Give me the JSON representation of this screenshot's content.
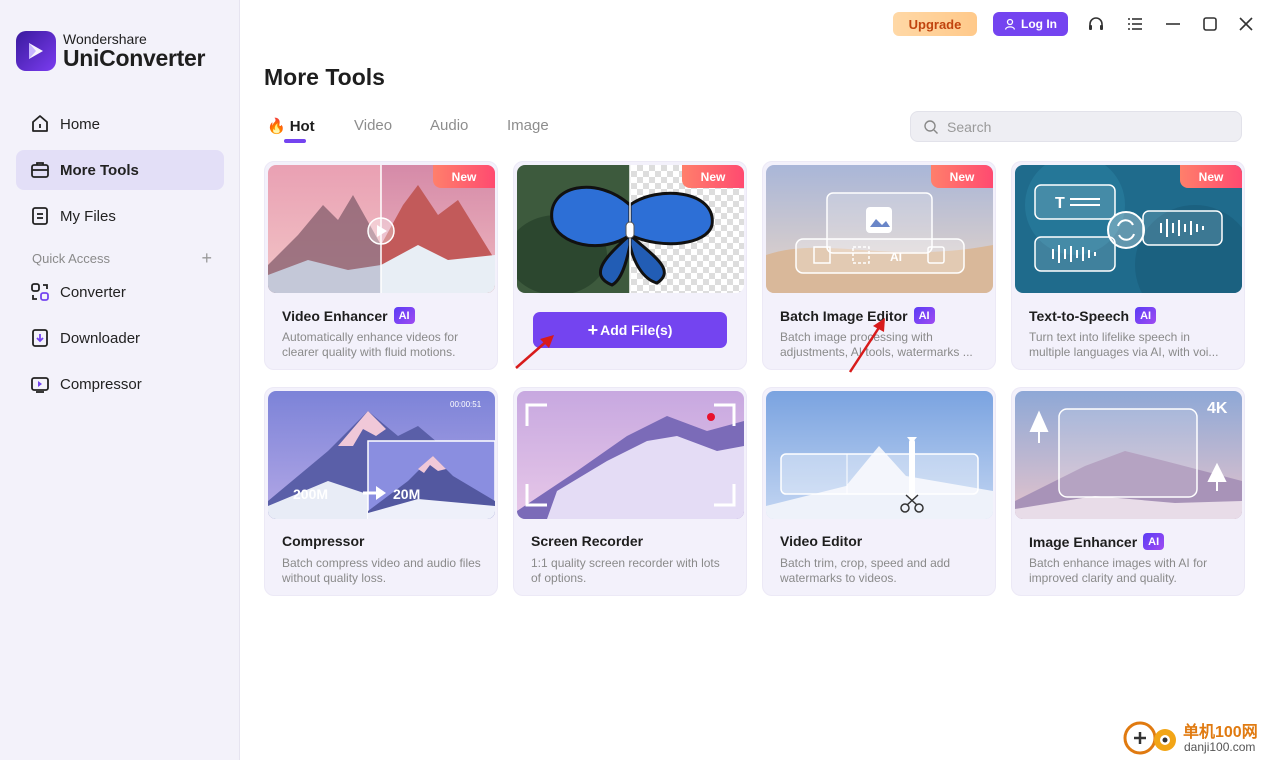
{
  "app": {
    "brand_line1": "Wondershare",
    "brand_line2": "UniConverter"
  },
  "sidebar": {
    "items": [
      {
        "label": "Home",
        "icon": "home-icon"
      },
      {
        "label": "More Tools",
        "icon": "toolbox-icon",
        "active": true
      },
      {
        "label": "My Files",
        "icon": "file-icon"
      }
    ],
    "quick_access_label": "Quick Access",
    "quick_items": [
      {
        "label": "Converter",
        "icon": "converter-icon"
      },
      {
        "label": "Downloader",
        "icon": "downloader-icon"
      },
      {
        "label": "Compressor",
        "icon": "compressor-icon"
      }
    ]
  },
  "topbar": {
    "upgrade_label": "Upgrade",
    "login_label": "Log In"
  },
  "main": {
    "title": "More Tools",
    "tabs": [
      "Hot",
      "Video",
      "Audio",
      "Image"
    ],
    "search_placeholder": "Search"
  },
  "cards": [
    {
      "title": "Video Enhancer",
      "ai": "AI",
      "badge": "New",
      "desc": "Automatically enhance videos for clearer quality with fluid motions."
    },
    {
      "badge": "New",
      "button": "Add File(s)"
    },
    {
      "title": "Batch Image Editor",
      "ai": "AI",
      "badge": "New",
      "desc": "Batch image processing with adjustments, AI tools, watermarks ..."
    },
    {
      "title": "Text-to-Speech",
      "ai": "AI",
      "badge": "New",
      "desc": "Turn text into lifelike speech in multiple languages via AI, with voi..."
    },
    {
      "title": "Compressor",
      "desc": "Batch compress video and audio files without quality loss.",
      "size_before": "200M",
      "size_after": "20M",
      "timecode": "00:00:51"
    },
    {
      "title": "Screen Recorder",
      "desc": "1:1 quality screen recorder with lots of options."
    },
    {
      "title": "Video Editor",
      "desc": "Batch trim, crop, speed and add watermarks to videos."
    },
    {
      "title": "Image Enhancer",
      "ai": "AI",
      "desc": "Batch enhance images with AI for improved clarity and quality.",
      "resolution": "4K"
    }
  ],
  "watermark": {
    "cn": "单机100网",
    "url": "danji100.com"
  },
  "colors": {
    "accent": "#7444f0",
    "upgrade_text": "#c1440e",
    "new_badge": "#ff5a6e"
  }
}
